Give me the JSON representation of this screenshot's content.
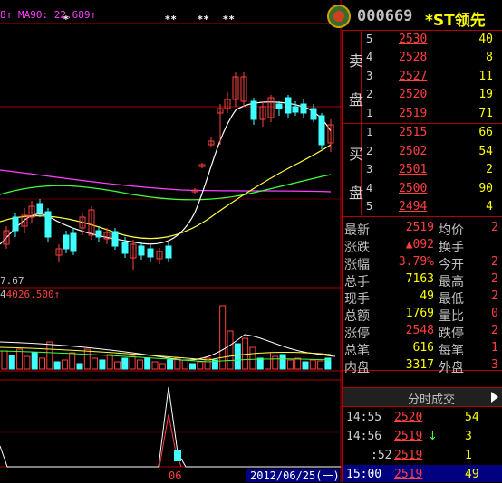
{
  "chart": {
    "ma_label_prefix": "8↑",
    "ma90_label": "MA90: 22.689↑",
    "star_marks": [
      "*",
      "**",
      "**",
      "**"
    ],
    "low_label": "7.67",
    "volume_label": "4026.500↑",
    "indicator_tick": "06",
    "date_label": "2012/06/25(一)",
    "colors": {
      "up": "#ff4040",
      "down": "#40ffff",
      "ma_white": "#ffffff",
      "ma_yellow": "#ffff40",
      "ma_green": "#40ff40",
      "ma_magenta": "#ff40ff"
    }
  },
  "header": {
    "stock_code": "000669",
    "stock_name": "*ST领先",
    "logo_icon": "app-logo"
  },
  "order_book": {
    "sell_label_top": "卖",
    "sell_label_bottom": "盘",
    "buy_label_top": "买",
    "buy_label_bottom": "盘",
    "sell": [
      {
        "level": "5",
        "price": "2530",
        "vol": "40"
      },
      {
        "level": "4",
        "price": "2528",
        "vol": "8"
      },
      {
        "level": "3",
        "price": "2527",
        "vol": "11"
      },
      {
        "level": "2",
        "price": "2520",
        "vol": "19"
      },
      {
        "level": "1",
        "price": "2519",
        "vol": "71"
      }
    ],
    "buy": [
      {
        "level": "1",
        "price": "2515",
        "vol": "66"
      },
      {
        "level": "2",
        "price": "2502",
        "vol": "54"
      },
      {
        "level": "3",
        "price": "2501",
        "vol": "2"
      },
      {
        "level": "4",
        "price": "2500",
        "vol": "90"
      },
      {
        "level": "5",
        "price": "2494",
        "vol": "4"
      }
    ]
  },
  "quote": [
    {
      "l1": "最新",
      "v1": "2519",
      "c1": "#ff4040",
      "l2": "均价",
      "v2": "2"
    },
    {
      "l1": "涨跌",
      "v1": "▲092",
      "c1": "#ff4040",
      "l2": "换手",
      "v2": ""
    },
    {
      "l1": "涨幅",
      "v1": "3.79%",
      "c1": "#ff4040",
      "l2": "今开",
      "v2": "2"
    },
    {
      "l1": "总手",
      "v1": "7163",
      "c1": "#ffff00",
      "l2": "最高",
      "v2": "2"
    },
    {
      "l1": "现手",
      "v1": "49",
      "c1": "#ffff00",
      "l2": "最低",
      "v2": "2"
    },
    {
      "l1": "总额",
      "v1": "1769",
      "c1": "#ffff00",
      "l2": "量比",
      "v2": "0"
    },
    {
      "l1": "涨停",
      "v1": "2548",
      "c1": "#ff4040",
      "l2": "跌停",
      "v2": "2"
    },
    {
      "l1": "总笔",
      "v1": "616",
      "c1": "#ffff00",
      "l2": "每笔",
      "v2": "1"
    },
    {
      "l1": "内盘",
      "v1": "3317",
      "c1": "#ffff00",
      "l2": "外盘",
      "v2": "3"
    }
  ],
  "ticks_tab_label": "分时成交",
  "ticks": [
    {
      "time": "14:55",
      "price": "2520",
      "arrow": "",
      "vol": "54"
    },
    {
      "time": "14:56",
      "price": "2519",
      "arrow": "↓",
      "vol": "3"
    },
    {
      "time": ":52",
      "price": "2519",
      "arrow": "",
      "vol": "1"
    },
    {
      "time": "15:00",
      "price": "2519",
      "arrow": "",
      "vol": "49"
    }
  ]
}
